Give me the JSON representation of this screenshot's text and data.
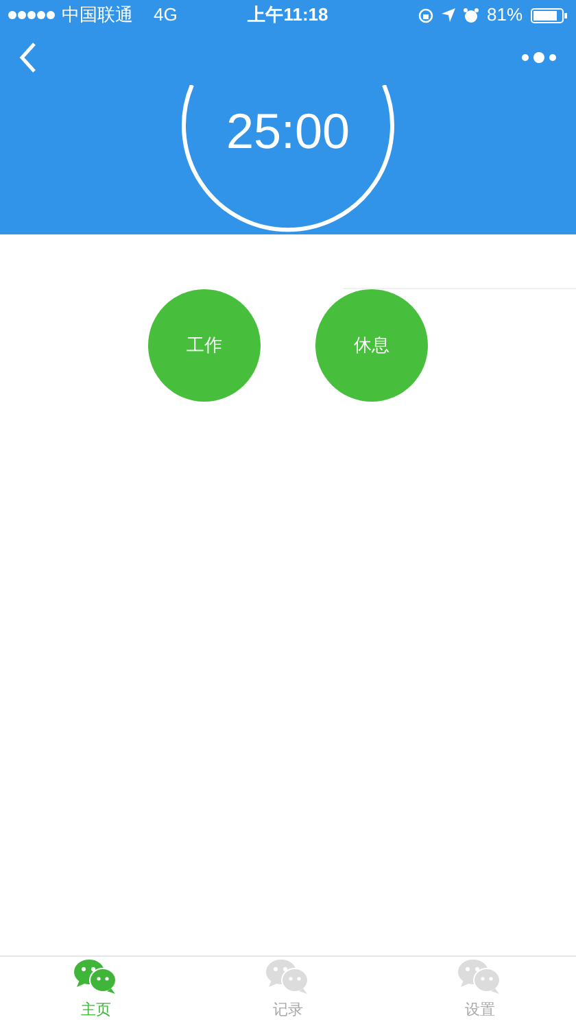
{
  "status_bar": {
    "carrier": "中国联通",
    "network": "4G",
    "time": "上午11:18",
    "battery": "81%"
  },
  "timer": {
    "display": "25:00"
  },
  "actions": [
    {
      "label": "工作"
    },
    {
      "label": "休息"
    }
  ],
  "tabs": [
    {
      "label": "主页",
      "selected": true
    },
    {
      "label": "记录",
      "selected": false
    },
    {
      "label": "设置",
      "selected": false
    }
  ]
}
